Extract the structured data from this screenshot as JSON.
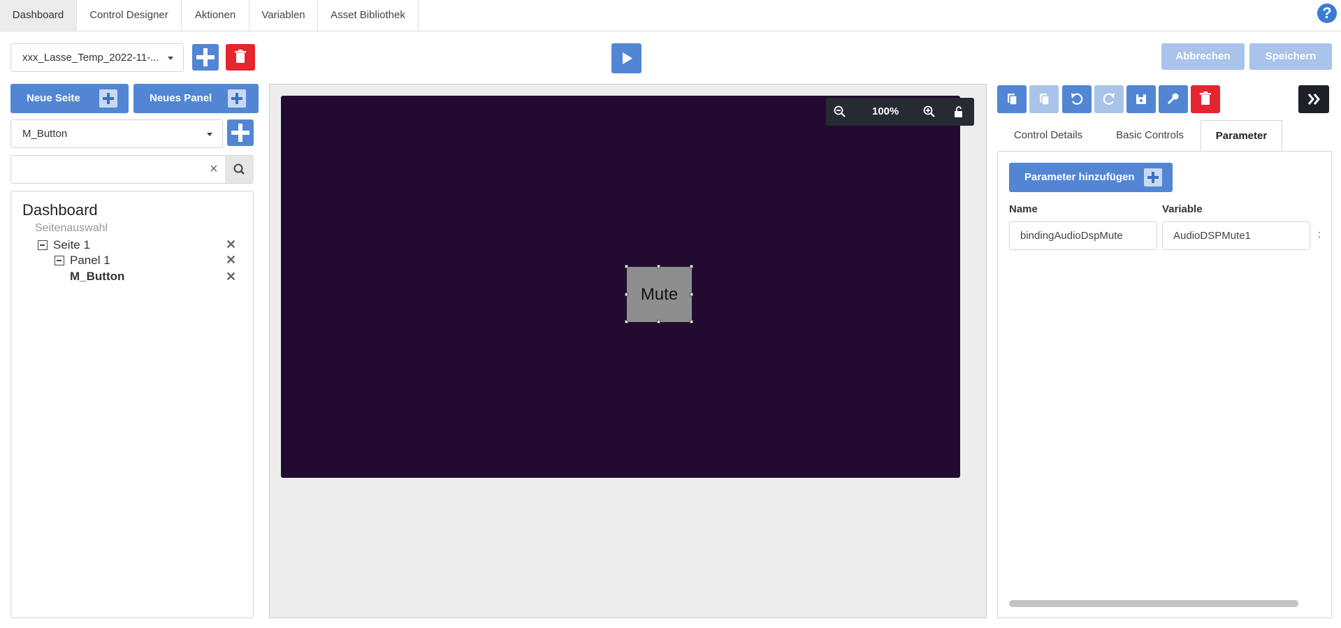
{
  "nav": {
    "tabs": [
      {
        "label": "Dashboard",
        "active": true
      },
      {
        "label": "Control Designer",
        "active": false
      },
      {
        "label": "Aktionen",
        "active": false
      },
      {
        "label": "Variablen",
        "active": false
      },
      {
        "label": "Asset Bibliothek",
        "active": false
      }
    ],
    "help_label": "?"
  },
  "toolbar": {
    "project_select": "xxx_Lasse_Temp_2022-11-...",
    "cancel_label": "Abbrechen",
    "save_label": "Speichern"
  },
  "left": {
    "new_page_label": "Neue Seite",
    "new_panel_label": "Neues Panel",
    "control_select": "M_Button",
    "search_placeholder": "",
    "clear_label": "×"
  },
  "tree": {
    "title": "Dashboard",
    "subtitle": "Seitenauswahl",
    "page": "Seite 1",
    "panel": "Panel 1",
    "control": "M_Button"
  },
  "canvas": {
    "zoom": "100%",
    "control_label": "Mute",
    "stage_color": "#220a30"
  },
  "right": {
    "tabs": [
      {
        "label": "Control Details",
        "active": false
      },
      {
        "label": "Basic Controls",
        "active": false
      },
      {
        "label": "Parameter",
        "active": true
      }
    ],
    "add_param_label": "Parameter hinzufügen",
    "col_name": "Name",
    "col_variable": "Variable",
    "param_name": "bindingAudioDspMute",
    "param_variable": "AudioDSPMute1",
    "overflow": ":"
  },
  "colors": {
    "accent": "#5286d4",
    "danger": "#e3262f",
    "disabled": "#a9c3ea"
  }
}
